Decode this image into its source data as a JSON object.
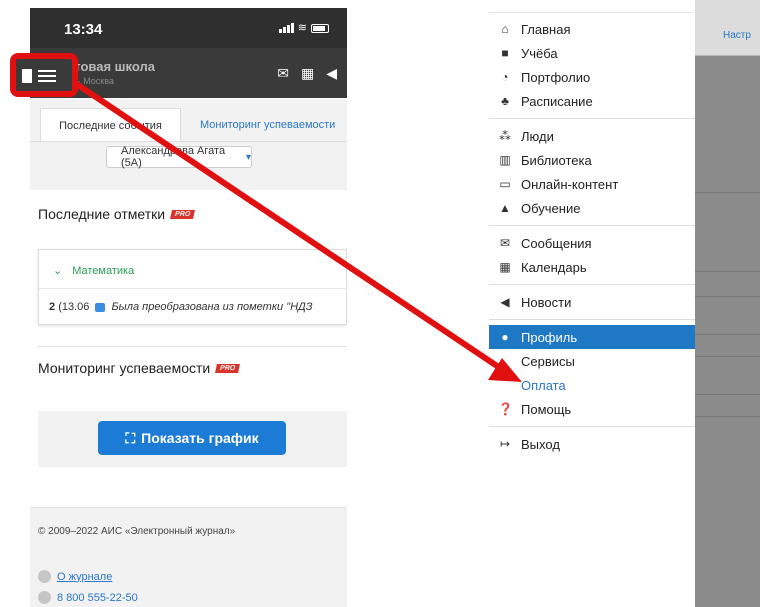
{
  "left_phone": {
    "status_time": "13:34",
    "school_name": "естовая школа",
    "school_city": "жка · Москва",
    "header_icons": [
      "mail-icon",
      "calendar-icon",
      "megaphone-icon"
    ],
    "tabs": [
      "Последние события",
      "Мониторинг успеваемости"
    ],
    "student": "Александрова Агата (5А)",
    "last_marks_title": "Последние отметки",
    "pro_label": "PRO",
    "subject": "Математика",
    "mark_value": "2",
    "mark_date": "(13.06",
    "mark_comment": "Была преобразована из пометки \"НДЗ",
    "monitoring_title": "Мониторинг успеваемости",
    "chart_button": "Показать график",
    "copyright": "© 2009–2022 АИС «Электронный журнал»",
    "about_link": "О журнале",
    "phone": "8 800 555-22-50"
  },
  "right_phone": {
    "overlay_text": "Настр",
    "menu_group1": [
      {
        "label": "Главная",
        "icon": "home-icon"
      },
      {
        "label": "Учёба",
        "icon": "book-icon"
      },
      {
        "label": "Портфолио",
        "icon": "pie-chart-icon"
      },
      {
        "label": "Расписание",
        "icon": "bell-icon"
      }
    ],
    "menu_group2": [
      {
        "label": "Люди",
        "icon": "users-icon"
      },
      {
        "label": "Библиотека",
        "icon": "library-icon"
      },
      {
        "label": "Онлайн-контент",
        "icon": "screen-icon"
      },
      {
        "label": "Обучение",
        "icon": "graduation-cap-icon"
      }
    ],
    "menu_group3": [
      {
        "label": "Сообщения",
        "icon": "envelope-icon"
      },
      {
        "label": "Календарь",
        "icon": "calendar-icon"
      }
    ],
    "menu_group4": [
      {
        "label": "Новости",
        "icon": "megaphone-icon"
      }
    ],
    "profile": "Профиль",
    "services": "Сервисы",
    "payment": "Оплата",
    "help": "Помощь",
    "logout": "Выход"
  },
  "colors": {
    "arrow": "#e01010",
    "accent": "#1f78c4",
    "pro_badge": "#d8342c",
    "subject": "#2b9b5b"
  }
}
